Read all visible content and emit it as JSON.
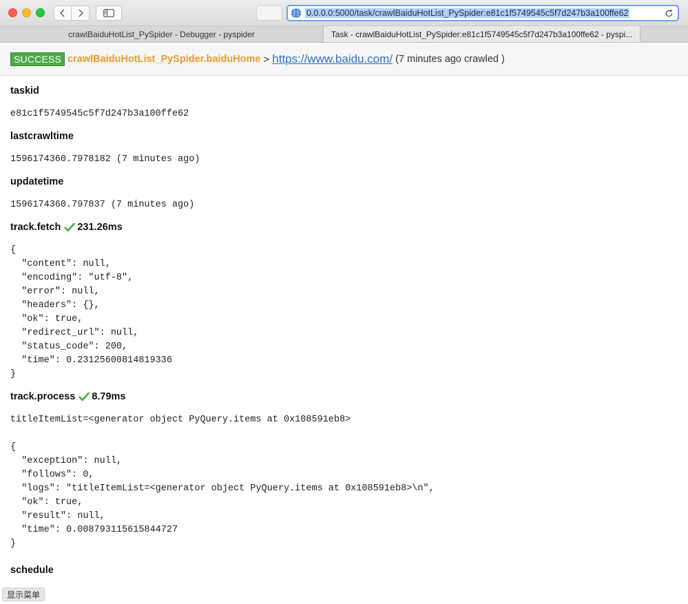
{
  "window": {
    "url": "0.0.0.0:5000/task/crawlBaiduHotList_PySpider:e81c1f5749545c5f7d247b3a100ffe62"
  },
  "tabs": [
    {
      "label": "crawlBaiduHotList_PySpider - Debugger - pyspider"
    },
    {
      "label": "Task - crawlBaiduHotList_PySpider:e81c1f5749545c5f7d247b3a100ffe62 - pyspi..."
    }
  ],
  "header": {
    "status": "SUCCESS",
    "project": "crawlBaiduHotList_PySpider.baiduHome",
    "separator": ">",
    "url": "https://www.baidu.com/",
    "crawled": "(7 minutes ago crawled )"
  },
  "sections": {
    "taskid": {
      "title": "taskid",
      "value": "e81c1f5749545c5f7d247b3a100ffe62"
    },
    "lastcrawltime": {
      "title": "lastcrawltime",
      "value": "1596174360.7978182 (7 minutes ago)"
    },
    "updatetime": {
      "title": "updatetime",
      "value": "1596174360.797837 (7 minutes ago)"
    },
    "fetch": {
      "title": "track.fetch",
      "time": "231.26ms",
      "json": "{\n  \"content\": null,\n  \"encoding\": \"utf-8\",\n  \"error\": null,\n  \"headers\": {},\n  \"ok\": true,\n  \"redirect_url\": null,\n  \"status_code\": 200,\n  \"time\": 0.23125600814819336\n}"
    },
    "process": {
      "title": "track.process",
      "time": "8.79ms",
      "log": "titleItemList=<generator object PyQuery.items at 0x108591eb8>",
      "json": "{\n  \"exception\": null,\n  \"follows\": 0,\n  \"logs\": \"titleItemList=<generator object PyQuery.items at 0x108591eb8>\\n\",\n  \"ok\": true,\n  \"result\": null,\n  \"time\": 0.008793115615844727\n}"
    },
    "schedule": {
      "title": "schedule",
      "json": "{}"
    }
  },
  "show_menu": "显示菜单",
  "colors": {
    "success": "#4aaa46",
    "project": "#e79d2f",
    "link": "#2d74c6",
    "check": "#4aaa46"
  },
  "icons": [
    "back-icon",
    "forward-icon",
    "sidebar-icon",
    "globe-icon",
    "reload-icon",
    "check-icon"
  ]
}
